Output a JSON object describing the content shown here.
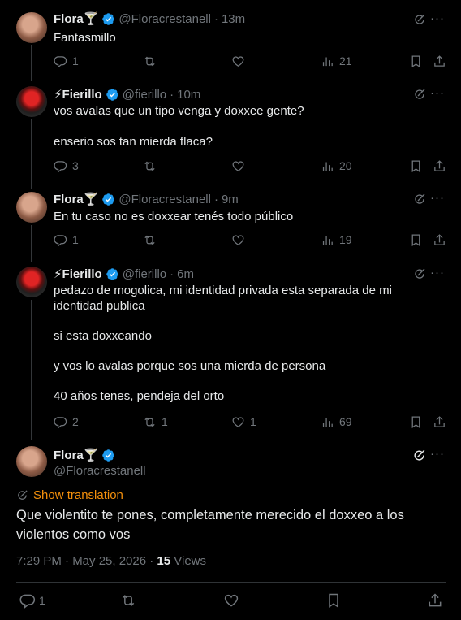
{
  "tweets": [
    {
      "author": "Flora🍸",
      "handle": "@Floracrestanell",
      "time": "13m",
      "text": [
        "Fantasmillo"
      ],
      "replies": "1",
      "retweets": "",
      "likes": "",
      "views": "21"
    },
    {
      "author": "⚡Fierillo",
      "handle": "@fierillo",
      "time": "10m",
      "text": [
        "vos avalas que un tipo venga y doxxee gente?",
        "enserio sos tan mierda flaca?"
      ],
      "replies": "3",
      "retweets": "",
      "likes": "",
      "views": "20"
    },
    {
      "author": "Flora🍸",
      "handle": "@Floracrestanell",
      "time": "9m",
      "text": [
        "En tu caso no es doxxear tenés todo público"
      ],
      "replies": "1",
      "retweets": "",
      "likes": "",
      "views": "19"
    },
    {
      "author": "⚡Fierillo",
      "handle": "@fierillo",
      "time": "6m",
      "text": [
        "pedazo de mogolica, mi identidad privada esta separada de mi identidad publica",
        "si esta doxxeando",
        "y vos lo avalas porque sos una mierda de persona",
        "40 años tenes, pendeja del orto"
      ],
      "replies": "2",
      "retweets": "1",
      "likes": "1",
      "views": "69"
    }
  ],
  "main": {
    "author": "Flora🍸",
    "handle": "@Floracrestanell",
    "show_translation": "Show translation",
    "text": "Que violentito te pones, completamente merecido el doxxeo a los violentos como vos",
    "timestamp": "7:29 PM · May 25, 2026 · ",
    "views_count": "15",
    "views_label": " Views",
    "replies": "1"
  },
  "common": {
    "separator": "·",
    "more": "···"
  },
  "colors": {
    "background": "#000000",
    "text": "#e7e9ea",
    "muted": "#71767b",
    "verified": "#1d9bf0",
    "translation_link": "#f4900c"
  }
}
